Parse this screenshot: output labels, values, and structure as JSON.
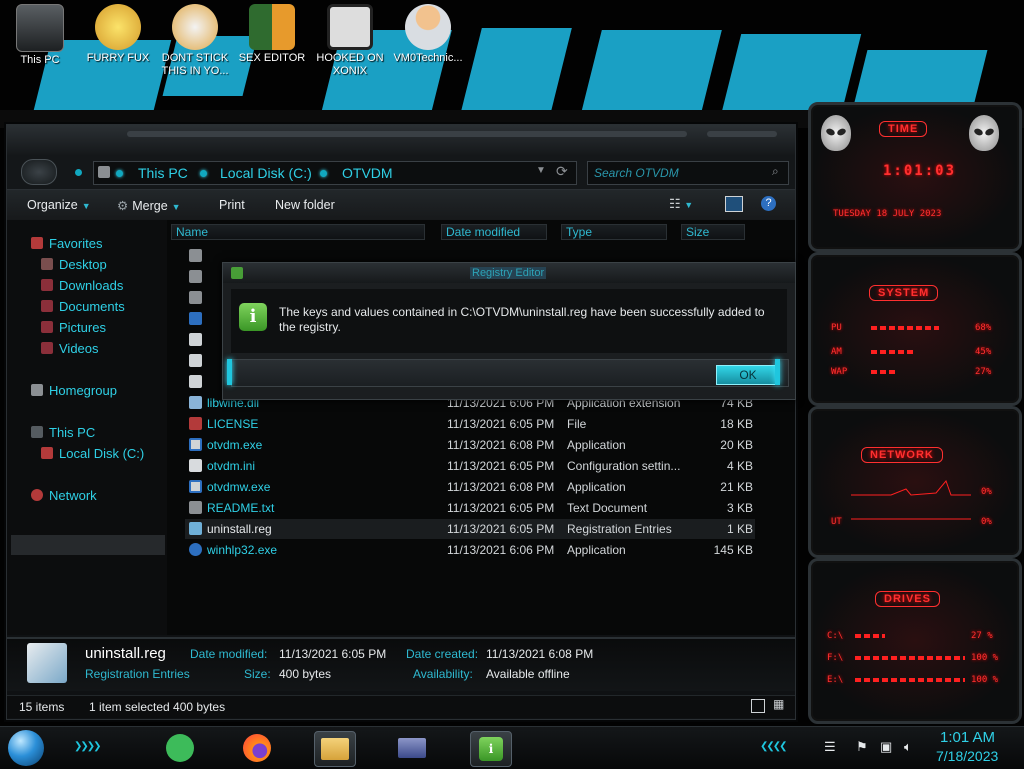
{
  "desktop": {
    "icons": [
      {
        "label": "This PC"
      },
      {
        "label": "FURRY FUX"
      },
      {
        "label": "DONT STICK THIS IN YO..."
      },
      {
        "label": "SEX EDITOR"
      },
      {
        "label": "HOOKED ON XONIX"
      },
      {
        "label": "VM0Technic..."
      }
    ]
  },
  "explorer": {
    "breadcrumb": [
      "This PC",
      "Local Disk (C:)",
      "OTVDM"
    ],
    "search_placeholder": "Search OTVDM",
    "toolbar": {
      "organize": "Organize",
      "merge": "Merge",
      "print": "Print",
      "new_folder": "New folder"
    },
    "nav": {
      "favorites": "Favorites",
      "desktop": "Desktop",
      "downloads": "Downloads",
      "documents": "Documents",
      "pictures": "Pictures",
      "videos": "Videos",
      "homegroup": "Homegroup",
      "this_pc": "This PC",
      "local_disk": "Local Disk (C:)",
      "network": "Network"
    },
    "columns": {
      "name": "Name",
      "date": "Date modified",
      "type": "Type",
      "size": "Size"
    },
    "files": [
      {
        "name": "libwine.dll",
        "date": "11/13/2021 6:06 PM",
        "type": "Application extension",
        "size": "74 KB"
      },
      {
        "name": "LICENSE",
        "date": "11/13/2021 6:05 PM",
        "type": "File",
        "size": "18 KB"
      },
      {
        "name": "otvdm.exe",
        "date": "11/13/2021 6:08 PM",
        "type": "Application",
        "size": "20 KB"
      },
      {
        "name": "otvdm.ini",
        "date": "11/13/2021 6:05 PM",
        "type": "Configuration settin...",
        "size": "4 KB"
      },
      {
        "name": "otvdmw.exe",
        "date": "11/13/2021 6:08 PM",
        "type": "Application",
        "size": "21 KB"
      },
      {
        "name": "README.txt",
        "date": "11/13/2021 6:05 PM",
        "type": "Text Document",
        "size": "3 KB"
      },
      {
        "name": "uninstall.reg",
        "date": "11/13/2021 6:05 PM",
        "type": "Registration Entries",
        "size": "1 KB"
      },
      {
        "name": "winhlp32.exe",
        "date": "11/13/2021 6:06 PM",
        "type": "Application",
        "size": "145 KB"
      }
    ],
    "details": {
      "filename": "uninstall.reg",
      "filetype": "Registration Entries",
      "modified_label": "Date modified:",
      "modified_value": "11/13/2021 6:05 PM",
      "size_label": "Size:",
      "size_value": "400 bytes",
      "created_label": "Date created:",
      "created_value": "11/13/2021 6:08 PM",
      "availability_label": "Availability:",
      "availability_value": "Available offline"
    },
    "status": {
      "items": "15 items",
      "selection": "1 item selected  400 bytes"
    }
  },
  "dialog": {
    "title": "Registry Editor",
    "message": "The keys and values contained in C:\\OTVDM\\uninstall.reg have been successfully added to the registry.",
    "ok": "OK"
  },
  "gadgets": {
    "time": {
      "title": "TIME",
      "clock": "1:01:03",
      "date": "TUESDAY 18 JULY 2023"
    },
    "system": {
      "title": "SYSTEM",
      "cpu_label": "PU",
      "cpu_value": "68%",
      "cpu_level": 0.68,
      "ram_label": "AM",
      "ram_value": "45%",
      "ram_level": 0.45,
      "swap_label": "WAP",
      "swap_value": "27%",
      "swap_level": 0.27
    },
    "network": {
      "title": "NETWORK",
      "in_value": "0%",
      "out_label": "UT",
      "out_value": "0%"
    },
    "drives": {
      "title": "DRIVES",
      "items": [
        {
          "label": "C:\\",
          "value": "27 %",
          "level": 0.27
        },
        {
          "label": "F:\\",
          "value": "100 %",
          "level": 1.0
        },
        {
          "label": "E:\\",
          "value": "100 %",
          "level": 1.0
        }
      ]
    }
  },
  "taskbar": {
    "time": "1:01 AM",
    "date": "7/18/2023"
  },
  "colors": {
    "accent": "#2fd0e6",
    "gadget_red": "#ff3030"
  }
}
